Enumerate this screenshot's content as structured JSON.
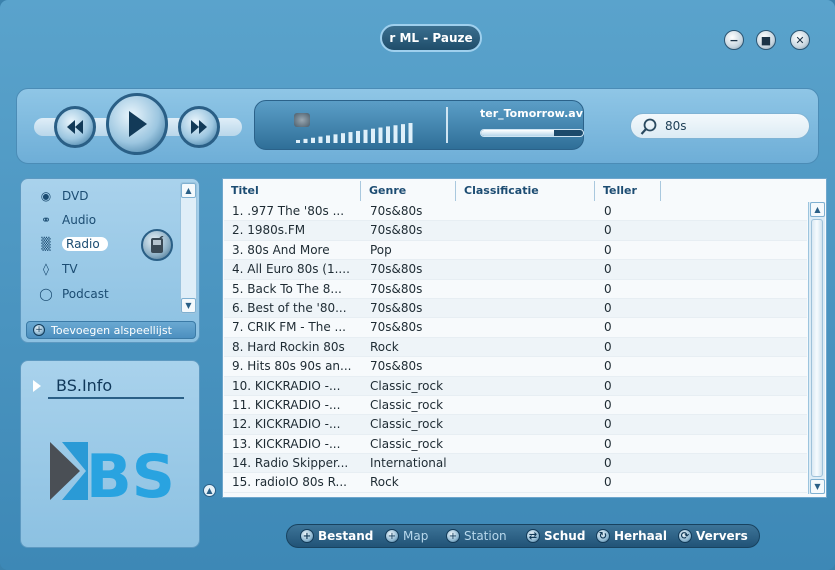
{
  "window": {
    "title": "r ML - Pauze",
    "buttons": {
      "minimize": "−",
      "maximize": "■",
      "close": "✕"
    }
  },
  "player": {
    "track_name": "ter_Tomorrow.av",
    "progress_fraction": 0.72,
    "volume_bars": 16
  },
  "search": {
    "value": "80s"
  },
  "nav": {
    "items": [
      {
        "label": "DVD",
        "icon": "disc-icon"
      },
      {
        "label": "Audio",
        "icon": "headphones-icon"
      },
      {
        "label": "Radio",
        "icon": "radio-icon",
        "active": true
      },
      {
        "label": "TV",
        "icon": "tv-icon"
      },
      {
        "label": "Podcast",
        "icon": "podcast-icon"
      }
    ],
    "add_playlist": "Toevoegen alspeellijst"
  },
  "info": {
    "title": "BS.Info",
    "logo_text": "BS"
  },
  "table": {
    "columns": [
      "Titel",
      "Genre",
      "Classificatie",
      "Teller"
    ],
    "rows": [
      [
        "1. .977 The '80s ...",
        "70s&80s",
        "",
        "0"
      ],
      [
        "2. 1980s.FM",
        "70s&80s",
        "",
        "0"
      ],
      [
        "3. 80s And More",
        "Pop",
        "",
        "0"
      ],
      [
        "4. All Euro 80s (1....",
        "70s&80s",
        "",
        "0"
      ],
      [
        "5. Back To The 8...",
        "70s&80s",
        "",
        "0"
      ],
      [
        "6. Best of the '80...",
        "70s&80s",
        "",
        "0"
      ],
      [
        "7. CRIK FM - The ...",
        "70s&80s",
        "",
        "0"
      ],
      [
        "8. Hard Rockin 80s",
        "Rock",
        "",
        "0"
      ],
      [
        "9. Hits 80s 90s an...",
        "70s&80s",
        "",
        "0"
      ],
      [
        "10. KICKRADIO -...",
        "Classic_rock",
        "",
        "0"
      ],
      [
        "11. KICKRADIO -...",
        "Classic_rock",
        "",
        "0"
      ],
      [
        "12. KICKRADIO -...",
        "Classic_rock",
        "",
        "0"
      ],
      [
        "13. KICKRADIO -...",
        "Classic_rock",
        "",
        "0"
      ],
      [
        "14. Radio Skipper...",
        "International",
        "",
        "0"
      ],
      [
        "15. radioIO 80s R...",
        "Rock",
        "",
        "0"
      ]
    ]
  },
  "toolbar": {
    "items": [
      {
        "label": "Bestand",
        "icon": "plus-icon",
        "dim": false
      },
      {
        "label": "Map",
        "icon": "plus-icon",
        "dim": true
      },
      {
        "label": "Station",
        "icon": "plus-icon",
        "dim": true
      },
      {
        "label": "Schud",
        "icon": "shuffle-icon",
        "dim": false
      },
      {
        "label": "Herhaal",
        "icon": "repeat-icon",
        "dim": false
      },
      {
        "label": "Ververs",
        "icon": "refresh-icon",
        "dim": false
      }
    ]
  }
}
